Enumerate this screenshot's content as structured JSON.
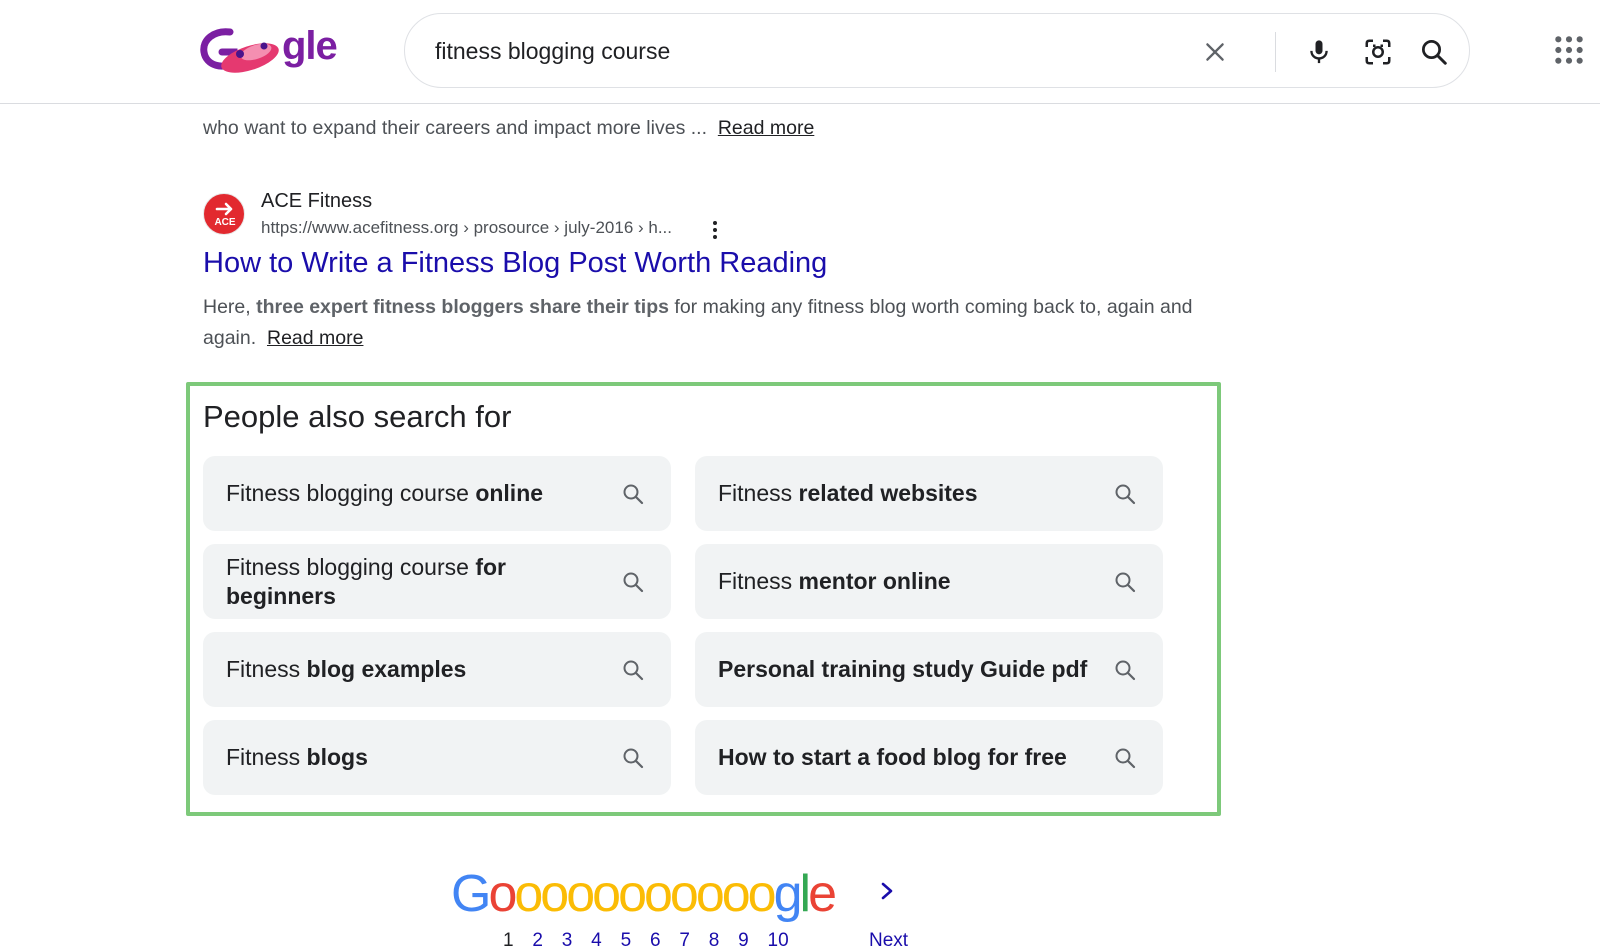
{
  "colors": {
    "link": "#1a0dab",
    "highlight_border": "#7dc97a",
    "chip_bg": "#f1f3f4",
    "ace_red": "#e2292f"
  },
  "header": {
    "logo_text": "gle",
    "search_value": "fitness blogging course",
    "icons": [
      "close-icon",
      "microphone-icon",
      "lens-camera-icon",
      "search-icon",
      "apps-grid-icon"
    ]
  },
  "prev_result": {
    "snippet": "who want to expand their careers and impact more lives ...",
    "read_more": "Read more"
  },
  "result": {
    "site_name": "ACE Fitness",
    "favicon_text": "ACE",
    "url": "https://www.acefitness.org › prosource › july-2016 › h...",
    "title": "How to Write a Fitness Blog Post Worth Reading",
    "snippet_prefix": "Here, ",
    "snippet_bold": "three expert fitness bloggers share their tips",
    "snippet_suffix": " for making any fitness blog worth coming back to, again and again.",
    "read_more": "Read more"
  },
  "people_also_search": {
    "title": "People also search for",
    "items": [
      {
        "normal": "Fitness blogging course ",
        "bold": "online"
      },
      {
        "normal": "Fitness ",
        "bold": "related websites"
      },
      {
        "normal": "Fitness blogging course ",
        "bold": "for beginners"
      },
      {
        "normal": "Fitness ",
        "bold": "mentor online"
      },
      {
        "normal": "Fitness ",
        "bold": "blog examples"
      },
      {
        "normal": "",
        "bold": "Personal training study Guide pdf"
      },
      {
        "normal": "Fitness ",
        "bold": "blogs"
      },
      {
        "normal": "",
        "bold": "How to start a food blog for free"
      }
    ]
  },
  "pagination": {
    "logo_text": "Gooooooooooogle",
    "current_page": "1",
    "pages": [
      "2",
      "3",
      "4",
      "5",
      "6",
      "7",
      "8",
      "9",
      "10"
    ],
    "next_label": "Next"
  }
}
